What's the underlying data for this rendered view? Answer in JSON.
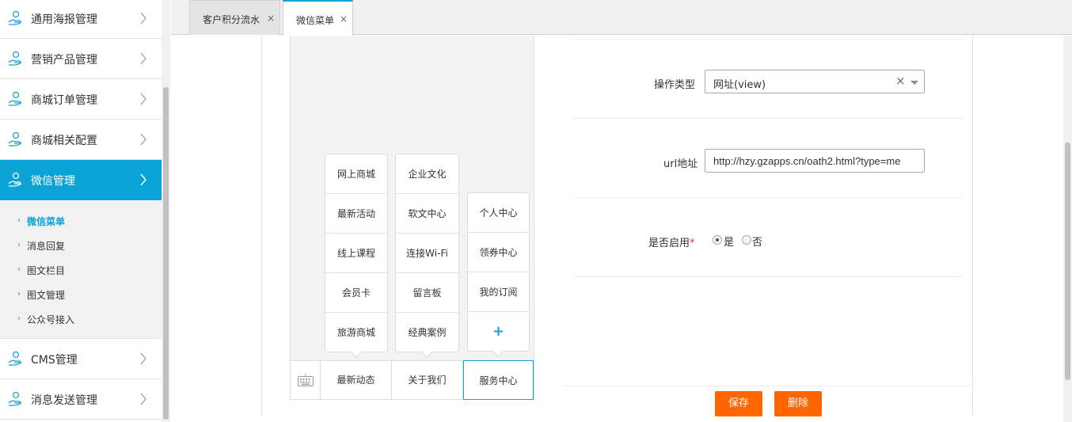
{
  "sidebar": {
    "menu": [
      {
        "label": "通用海报管理",
        "icon": "user-money-icon"
      },
      {
        "label": "营销产品管理",
        "icon": "user-money-icon"
      },
      {
        "label": "商城订单管理",
        "icon": "user-money-icon"
      },
      {
        "label": "商城相关配置",
        "icon": "user-money-icon"
      },
      {
        "label": "微信管理",
        "icon": "user-money-icon",
        "active": true
      },
      {
        "label": "CMS管理",
        "icon": "user-money-icon"
      },
      {
        "label": "消息发送管理",
        "icon": "user-money-icon"
      }
    ],
    "submenu": [
      {
        "label": "微信菜单",
        "active": true
      },
      {
        "label": "消息回复"
      },
      {
        "label": "图文栏目"
      },
      {
        "label": "图文管理"
      },
      {
        "label": "公众号接入"
      }
    ]
  },
  "tabs": [
    {
      "label": "客户积分流水",
      "close": "×"
    },
    {
      "label": "微信菜单",
      "close": "×",
      "active": true
    }
  ],
  "preview": {
    "columns": [
      [
        "网上商城",
        "最新活动",
        "线上课程",
        "会员卡",
        "旅游商城"
      ],
      [
        "企业文化",
        "软文中心",
        "连接Wi-Fi",
        "留言板",
        "经典案例"
      ],
      [
        "个人中心",
        "领券中心",
        "我的订阅",
        "+"
      ]
    ],
    "main_buttons": [
      "最新动态",
      "关于我们",
      "服务中心"
    ]
  },
  "form": {
    "op_type_label": "操作类型",
    "op_type_value": "网址(view)",
    "clear_symbol": "×",
    "url_label": "url地址",
    "url_value": "http://hzy.gzapps.cn/oath2.html?type=me",
    "enable_label": "是否启用",
    "required_mark": "*",
    "yes_label": "是",
    "no_label": "否",
    "save_label": "保存",
    "delete_label": "删除"
  },
  "colors": {
    "accent": "#0ba2d6",
    "button": "#ff6600"
  }
}
